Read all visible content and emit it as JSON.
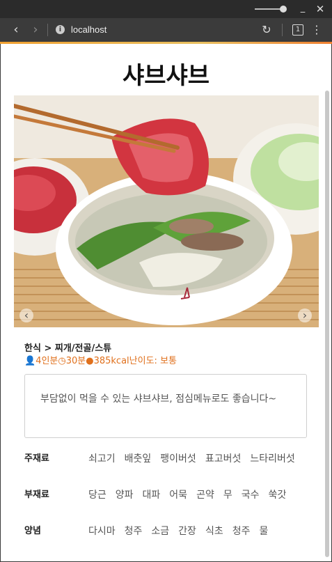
{
  "browser": {
    "url": "localhost",
    "tab_count": "1"
  },
  "recipe": {
    "title": "샤브샤브",
    "breadcrumb": "한식 > 찌개/전골/스튜",
    "servings": "4인분",
    "time": "30분",
    "calories": "385kcal",
    "difficulty": "난이도: 보통",
    "description": "부담없이 먹을 수 있는 샤브샤브, 점심메뉴로도 좋습니다~"
  },
  "ingredients": {
    "main_label": "주재료",
    "main": [
      "쇠고기",
      "배춧잎",
      "팽이버섯",
      "표고버섯",
      "느타리버섯"
    ],
    "sub_label": "부재료",
    "sub": [
      "당근",
      "양파",
      "대파",
      "어묵",
      "곤약",
      "무",
      "국수",
      "쑥갓"
    ],
    "sauce_label": "양념",
    "sauce": [
      "다시마",
      "청주",
      "소금",
      "간장",
      "식초",
      "청주",
      "물"
    ]
  },
  "colors": {
    "accent": "#e0701c",
    "chrome_dark": "#2b2b2b",
    "toolbar": "#3b3b3b"
  }
}
